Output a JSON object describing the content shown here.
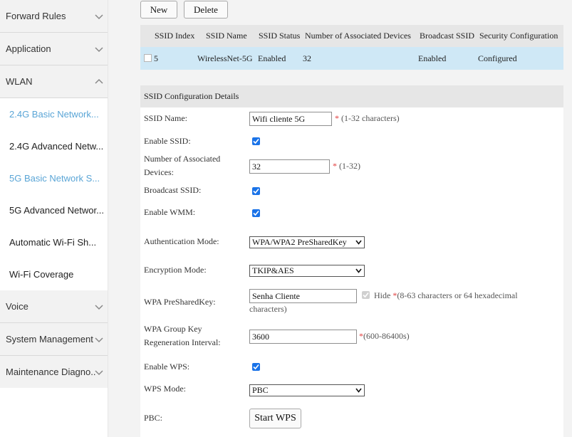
{
  "sidebar": {
    "menus": [
      {
        "label": "Forward Rules",
        "expanded": false
      },
      {
        "label": "Application",
        "expanded": false
      },
      {
        "label": "WLAN",
        "expanded": true
      },
      {
        "label": "Voice",
        "expanded": false
      },
      {
        "label": "System Management",
        "expanded": false
      },
      {
        "label": "Maintenance Diagno..",
        "expanded": false
      }
    ],
    "wlan_items": [
      {
        "label": "2.4G Basic Network...",
        "active": true
      },
      {
        "label": "2.4G Advanced Netw...",
        "active": false
      },
      {
        "label": "5G Basic Network S...",
        "active": true
      },
      {
        "label": "5G Advanced Networ...",
        "active": false
      },
      {
        "label": "Automatic Wi-Fi Sh...",
        "active": false
      },
      {
        "label": "Wi-Fi Coverage",
        "active": false
      }
    ]
  },
  "toolbar": {
    "new_label": "New",
    "delete_label": "Delete"
  },
  "ssid_table": {
    "headers": [
      "SSID Index",
      "SSID Name",
      "SSID Status",
      "Number of Associated Devices",
      "Broadcast SSID",
      "Security Configuration"
    ],
    "rows": [
      {
        "index": "5",
        "name": "WirelessNet-5G",
        "status": "Enabled",
        "devices": "32",
        "broadcast": "Enabled",
        "security": "Configured"
      }
    ]
  },
  "details": {
    "title": "SSID Configuration Details",
    "ssid_name_label": "SSID Name:",
    "ssid_name_value": "Wifi cliente 5G",
    "ssid_name_hint": "(1-32 characters)",
    "enable_ssid_label": "Enable SSID:",
    "devices_label_1": "Number of Associated",
    "devices_label_2": "Devices:",
    "devices_value": "32",
    "devices_hint": "(1-32)",
    "broadcast_label": "Broadcast SSID:",
    "wmm_label": "Enable WMM:",
    "auth_label": "Authentication Mode:",
    "auth_value": "WPA/WPA2 PreSharedKey",
    "enc_label": "Encryption Mode:",
    "enc_value": "TKIP&AES",
    "psk_label": "WPA PreSharedKey:",
    "psk_value": "Senha Cliente",
    "hide_label": "Hide",
    "psk_hint_1": "(8-63 characters or 64 hexadecimal",
    "psk_hint_2": "characters)",
    "group_key_label_1": "WPA Group Key",
    "group_key_label_2": "Regeneration Interval:",
    "group_key_value": "3600",
    "group_key_hint": "(600-86400s)",
    "wps_label": "Enable WPS:",
    "wps_mode_label": "WPS Mode:",
    "wps_mode_value": "PBC",
    "pbc_label": "PBC:",
    "start_wps_label": "Start WPS",
    "required_mark": "*"
  },
  "colors": {
    "accent": "#1a73e8",
    "active_link": "#5aa5d6",
    "selected_row": "#cfe8f6",
    "required": "#e03a3a"
  }
}
